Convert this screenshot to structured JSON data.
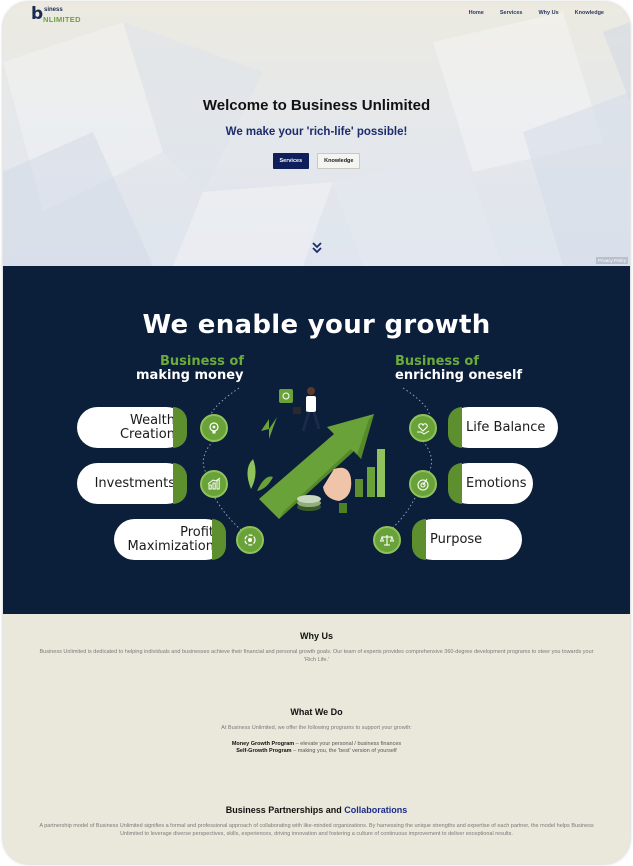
{
  "nav": {
    "logo_mark": "b",
    "logo_top": "siness",
    "logo_bottom": "NLIMITED",
    "links": [
      "Home",
      "Services",
      "Why Us",
      "Knowledge"
    ]
  },
  "hero": {
    "title": "Welcome to Business Unlimited",
    "subtitle": "We make your 'rich-life' possible!",
    "btn_services": "Services",
    "btn_knowledge": "Knowledge",
    "privacy": "Privacy Policy"
  },
  "growth": {
    "title": "We enable your growth",
    "left_head_green": "Business of",
    "left_head_white": "making money",
    "right_head_green": "Business of",
    "right_head_white": "enriching oneself",
    "left_items": [
      {
        "line1": "Wealth",
        "line2": "Creation",
        "icon": "lightbulb-gear-icon"
      },
      {
        "line1": "Investments",
        "line2": "",
        "icon": "bar-chart-icon"
      },
      {
        "line1": "Profit",
        "line2": "Maximization",
        "icon": "settings-cycle-icon"
      }
    ],
    "right_items": [
      {
        "label": "Life Balance",
        "icon": "heart-hand-icon"
      },
      {
        "label": "Emotions",
        "icon": "target-icon"
      },
      {
        "label": "Purpose",
        "icon": "scale-icon"
      }
    ],
    "colors": {
      "navy": "#0b1e3a",
      "green": "#6aa23a",
      "dark_green": "#5e8f2e"
    }
  },
  "why_us": {
    "title": "Why Us",
    "text": "Business Unlimited is dedicated to helping individuals and businesses achieve their financial and personal growth goals. Our team of experts provides comprehensive 360-degree development programs to steer you towards your 'Rich Life.'"
  },
  "what_we_do": {
    "title": "What We Do",
    "intro": "At Business Unlimited, we offer the following programs to support your growth:",
    "programs": [
      {
        "name": "Money Growth Program",
        "desc": " – elevate your personal / business finances"
      },
      {
        "name": "Self-Growth Program",
        "desc": " – making you, the 'best' version of yourself"
      }
    ]
  },
  "partnerships": {
    "title_black": "Business Partnerships and ",
    "title_blue": "Collaborations",
    "text": "A partnership model of Business Unlimited signifies a formal and professional approach of collaborating with like-minded organizations. By harnessing the unique strengths and expertise of each partner, the model helps Business Unlimited to leverage diverse perspectives, skills, experiences, driving innovation and fostering a culture of continuous improvement to deliver exceptional results."
  }
}
